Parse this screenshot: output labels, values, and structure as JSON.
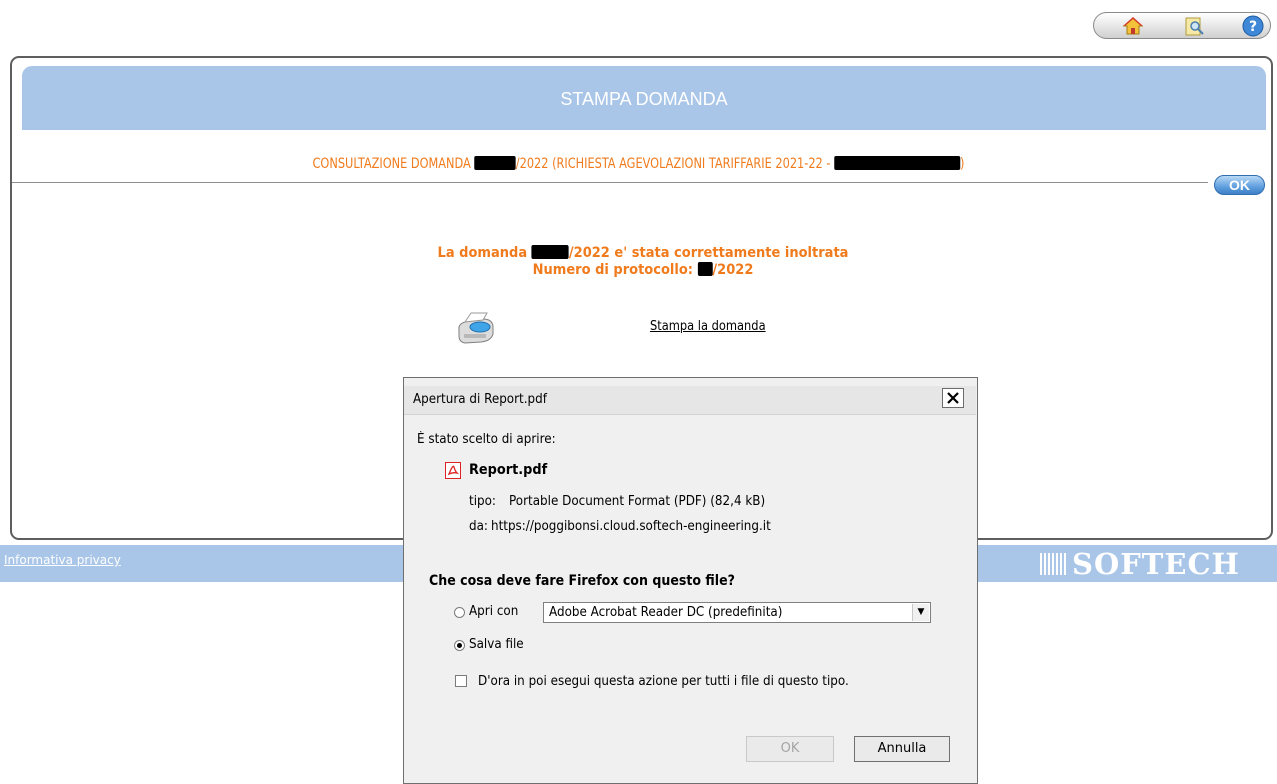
{
  "toolbar": {
    "buttons": [
      {
        "icon": "home-icon"
      },
      {
        "icon": "search-document-icon"
      },
      {
        "icon": "help-icon"
      }
    ]
  },
  "header": {
    "title": "STAMPA DOMANDA"
  },
  "consultation": {
    "prefix": "CONSULTAZIONE DOMANDA ",
    "middle": "/2022 (RICHIESTA AGEVOLAZIONI TARIFFARIE 2021-22 - ",
    "suffix": ")"
  },
  "ok_label": "OK",
  "message": {
    "line1_prefix": "La domanda ",
    "line1_suffix": "/2022 e' stata correttamente inoltrata",
    "line2_prefix": "Numero di protocollo: ",
    "line2_suffix": "/2022"
  },
  "print_link": "Stampa la domanda",
  "footer": {
    "privacy": "Informativa privacy",
    "logo": "SOFTECH"
  },
  "dialog": {
    "title": "Apertura di Report.pdf",
    "close": "x",
    "intro": "È stato scelto di aprire:",
    "filename": "Report.pdf",
    "type_label": "tipo:",
    "type_value": "Portable Document Format (PDF) (82,4 kB)",
    "from_label": "da:",
    "from_value": "https://poggibonsi.cloud.softech-engineering.it",
    "question": "Che cosa deve fare Firefox con questo file?",
    "open_with_label": "Apri con",
    "open_with_value": "Adobe Acrobat Reader DC  (predefinita)",
    "save_label": "Salva file",
    "selected_option": "save",
    "remember_label": "D'ora in poi esegui questa azione per tutti i file di questo tipo.",
    "remember_checked": false,
    "ok_button": "OK",
    "cancel_button": "Annulla"
  }
}
